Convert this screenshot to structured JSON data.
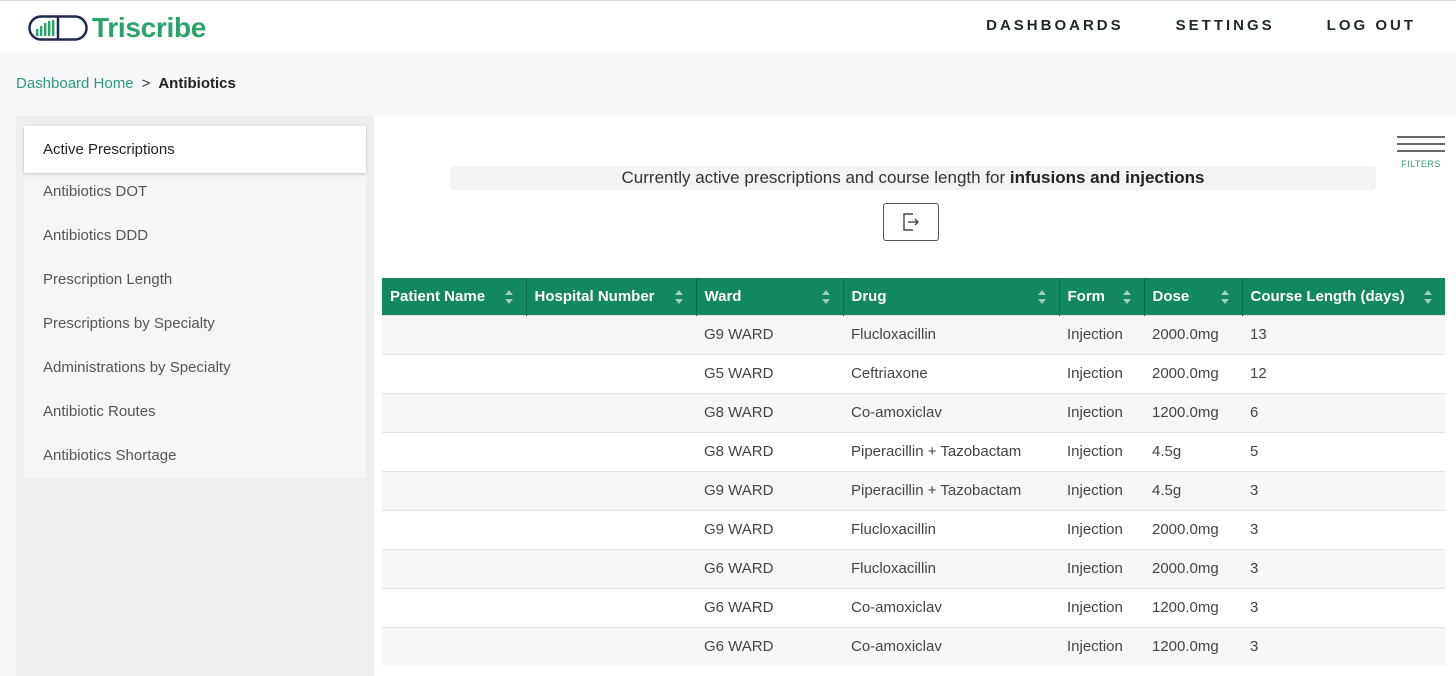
{
  "app": {
    "name": "Triscribe",
    "brand_color": "#29a36a"
  },
  "nav": {
    "items": [
      "DASHBOARDS",
      "SETTINGS",
      "LOG OUT"
    ]
  },
  "breadcrumb": {
    "home": "Dashboard Home",
    "separator": ">",
    "current": "Antibiotics"
  },
  "sidebar": {
    "items": [
      "Active Prescriptions",
      "Antibiotics DOT",
      "Antibiotics DDD",
      "Prescription Length",
      "Prescriptions by Specialty",
      "Administrations by Specialty",
      "Antibiotic Routes",
      "Antibiotics Shortage"
    ],
    "active_index": 0
  },
  "main": {
    "caption_prefix": "Currently active prescriptions and course length for ",
    "caption_bold": "infusions and injections",
    "filters_label": "FILTERS",
    "export_icon": "export-icon"
  },
  "table": {
    "header_color": "#13875e",
    "columns": [
      "Patient Name",
      "Hospital Number",
      "Ward",
      "Drug",
      "Form",
      "Dose",
      "Course Length (days)"
    ],
    "rows": [
      [
        "",
        "",
        "G9 WARD",
        "Flucloxacillin",
        "Injection",
        "2000.0mg",
        "13"
      ],
      [
        "",
        "",
        "G5 WARD",
        "Ceftriaxone",
        "Injection",
        "2000.0mg",
        "12"
      ],
      [
        "",
        "",
        "G8 WARD",
        "Co-amoxiclav",
        "Injection",
        "1200.0mg",
        "6"
      ],
      [
        "",
        "",
        "G8 WARD",
        "Piperacillin + Tazobactam",
        "Injection",
        "4.5g",
        "5"
      ],
      [
        "",
        "",
        "G9 WARD",
        "Piperacillin + Tazobactam",
        "Injection",
        "4.5g",
        "3"
      ],
      [
        "",
        "",
        "G9 WARD",
        "Flucloxacillin",
        "Injection",
        "2000.0mg",
        "3"
      ],
      [
        "",
        "",
        "G6 WARD",
        "Flucloxacillin",
        "Injection",
        "2000.0mg",
        "3"
      ],
      [
        "",
        "",
        "G6 WARD",
        "Co-amoxiclav",
        "Injection",
        "1200.0mg",
        "3"
      ],
      [
        "",
        "",
        "G6 WARD",
        "Co-amoxiclav",
        "Injection",
        "1200.0mg",
        "3"
      ]
    ]
  }
}
